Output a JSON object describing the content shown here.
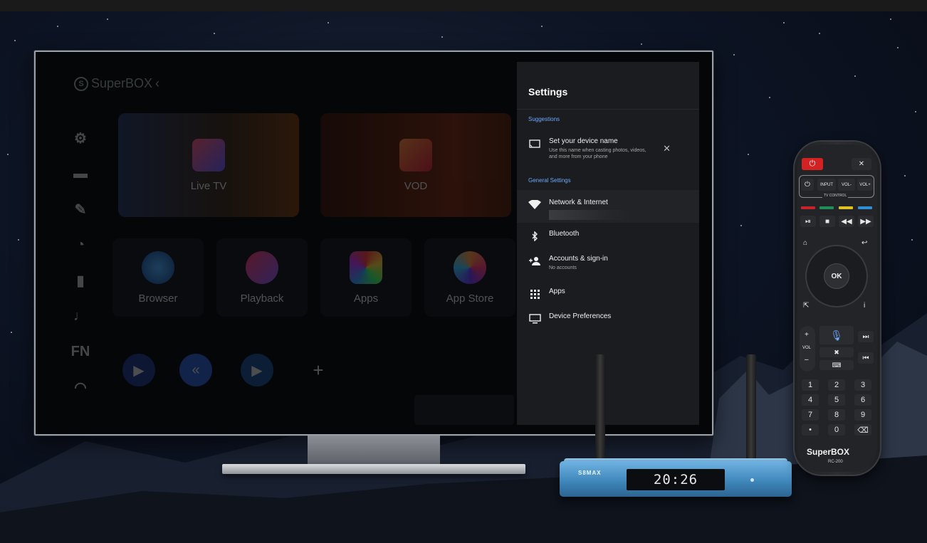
{
  "brand": {
    "logo_text": "SuperBOX",
    "logo_badge": "S"
  },
  "tv": {
    "sidebar_icons": [
      {
        "name": "gear-icon",
        "glyph": "⚙"
      },
      {
        "name": "folder-icon",
        "glyph": "▬"
      },
      {
        "name": "broom-icon",
        "glyph": "✎"
      },
      {
        "name": "speedometer-icon",
        "glyph": "◔"
      },
      {
        "name": "trash-icon",
        "glyph": "▮"
      },
      {
        "name": "microphone-icon",
        "glyph": "♩"
      },
      {
        "name": "fn-icon",
        "glyph": "FN"
      },
      {
        "name": "headset-icon",
        "glyph": "◠"
      }
    ],
    "big_tiles": [
      {
        "label": "Live TV"
      },
      {
        "label": "VOD"
      }
    ],
    "tiles": [
      {
        "label": "Browser"
      },
      {
        "label": "Playback"
      },
      {
        "label": "Apps"
      },
      {
        "label": "App Store"
      }
    ],
    "dock_add": "+"
  },
  "settings": {
    "title": "Settings",
    "suggestions_label": "Suggestions",
    "suggestion": {
      "title": "Set your device name",
      "subtitle_line1": "Use this name when casting photos, videos,",
      "subtitle_line2": "and more from your phone",
      "close": "✕"
    },
    "general_label": "General Settings",
    "items": [
      {
        "label": "Network & Internet",
        "sub": ""
      },
      {
        "label": "Bluetooth",
        "sub": ""
      },
      {
        "label": "Accounts & sign-in",
        "sub": "No accounts"
      },
      {
        "label": "Apps",
        "sub": ""
      },
      {
        "label": "Device Preferences",
        "sub": ""
      }
    ]
  },
  "box": {
    "brand": "S8MAX",
    "display_time": "20:26"
  },
  "remote": {
    "input": "INPUT",
    "vol_minus": "VOL-",
    "vol_plus": "VOL+",
    "tv_control": "TV CONTROL",
    "ok": "OK",
    "vol": "VOL",
    "plus": "+",
    "minus": "–",
    "info": "i",
    "keys": [
      "1",
      "2",
      "3",
      "4",
      "5",
      "6",
      "7",
      "8",
      "9",
      "•",
      "0",
      "⌫"
    ],
    "logo": "SuperBOX",
    "model": "RC-200"
  },
  "colors": {
    "accent_blue": "#6ea8ff",
    "panel": "#1b1c1f",
    "remote_red": "#d32222",
    "remote_colors": [
      "#c8232c",
      "#1f8f5a",
      "#e0c323",
      "#2f8fd6"
    ]
  }
}
